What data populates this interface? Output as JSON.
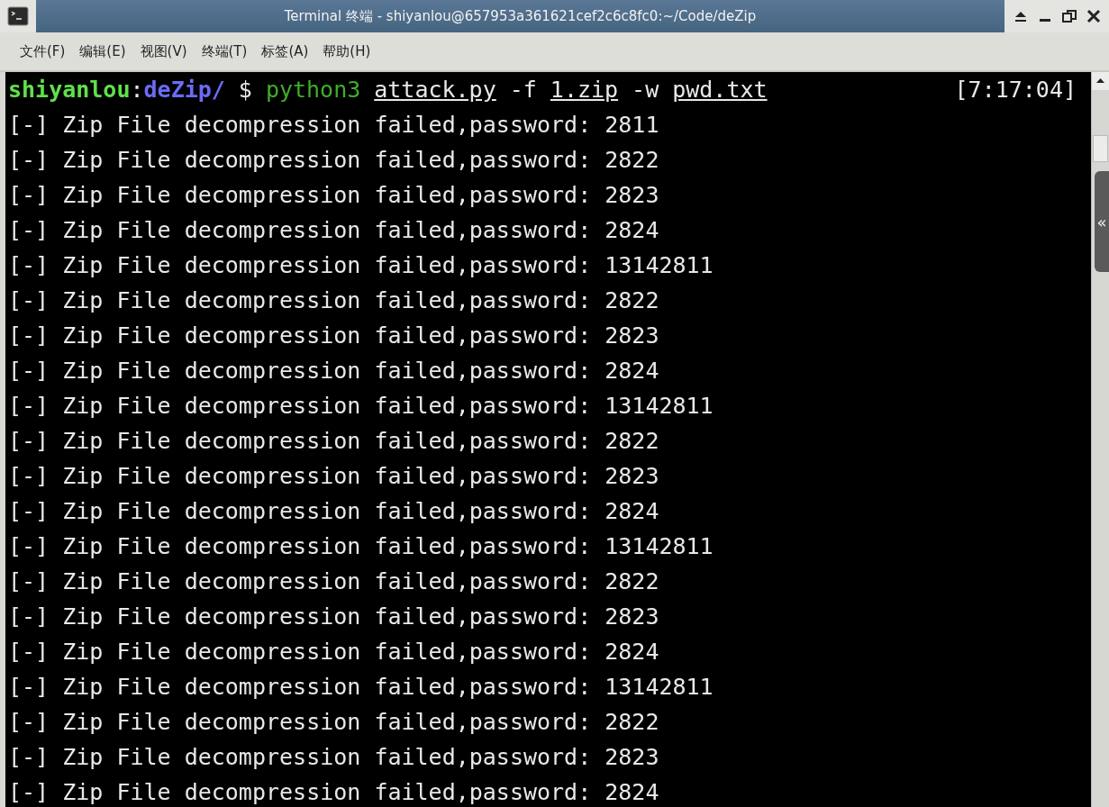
{
  "window": {
    "title": "Terminal 终端 - shiyanlou@657953a361621cef2c6c8fc0:~/Code/deZip"
  },
  "menu": [
    {
      "label": "文件(F)"
    },
    {
      "label": "编辑(E)"
    },
    {
      "label": "视图(V)"
    },
    {
      "label": "终端(T)"
    },
    {
      "label": "标签(A)"
    },
    {
      "label": "帮助(H)"
    }
  ],
  "prompt": {
    "segments": [
      {
        "text": "shiyanlou",
        "kind": "user",
        "underlined": false
      },
      {
        "text": ":",
        "kind": "sep",
        "underlined": false
      },
      {
        "text": "deZip/",
        "kind": "dir",
        "underlined": false
      },
      {
        "text": "$",
        "kind": "symbol",
        "underlined": false
      },
      {
        "text": "python3",
        "kind": "command",
        "underlined": false
      },
      {
        "text": "attack.py",
        "kind": "arg",
        "underlined": true
      },
      {
        "text": "-f",
        "kind": "arg",
        "underlined": false
      },
      {
        "text": "1.zip",
        "kind": "arg",
        "underlined": true
      },
      {
        "text": "-w",
        "kind": "arg",
        "underlined": false
      },
      {
        "text": "pwd.txt",
        "kind": "arg",
        "underlined": true
      }
    ],
    "time": "[7:17:04]"
  },
  "output": [
    "[-] Zip File decompression failed,password: 2811",
    "[-] Zip File decompression failed,password: 2822",
    "[-] Zip File decompression failed,password: 2823",
    "[-] Zip File decompression failed,password: 2824",
    "[-] Zip File decompression failed,password: 13142811",
    "[-] Zip File decompression failed,password: 2822",
    "[-] Zip File decompression failed,password: 2823",
    "[-] Zip File decompression failed,password: 2824",
    "[-] Zip File decompression failed,password: 13142811",
    "[-] Zip File decompression failed,password: 2822",
    "[-] Zip File decompression failed,password: 2823",
    "[-] Zip File decompression failed,password: 2824",
    "[-] Zip File decompression failed,password: 13142811",
    "[-] Zip File decompression failed,password: 2822",
    "[-] Zip File decompression failed,password: 2823",
    "[-] Zip File decompression failed,password: 2824",
    "[-] Zip File decompression failed,password: 13142811",
    "[-] Zip File decompression failed,password: 2822",
    "[-] Zip File decompression failed,password: 2823",
    "[-] Zip File decompression failed,password: 2824"
  ],
  "side_tab": {
    "label": "«"
  }
}
